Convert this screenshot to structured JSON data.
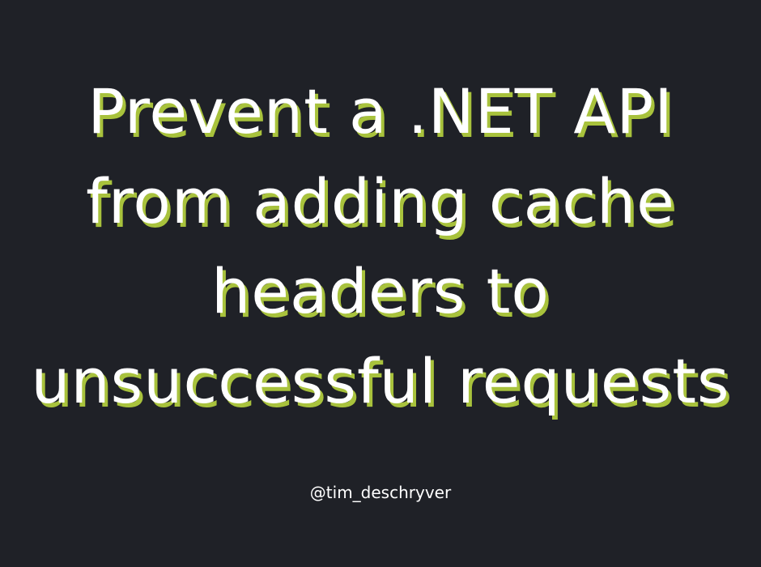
{
  "title_lines": [
    "Prevent a .NET API",
    "from adding cache",
    "headers to",
    "unsuccessful requests"
  ],
  "author_handle": "@tim_deschryver",
  "colors": {
    "background": "#1f2127",
    "text": "#ffffff",
    "shadow": "#a8c23c"
  }
}
